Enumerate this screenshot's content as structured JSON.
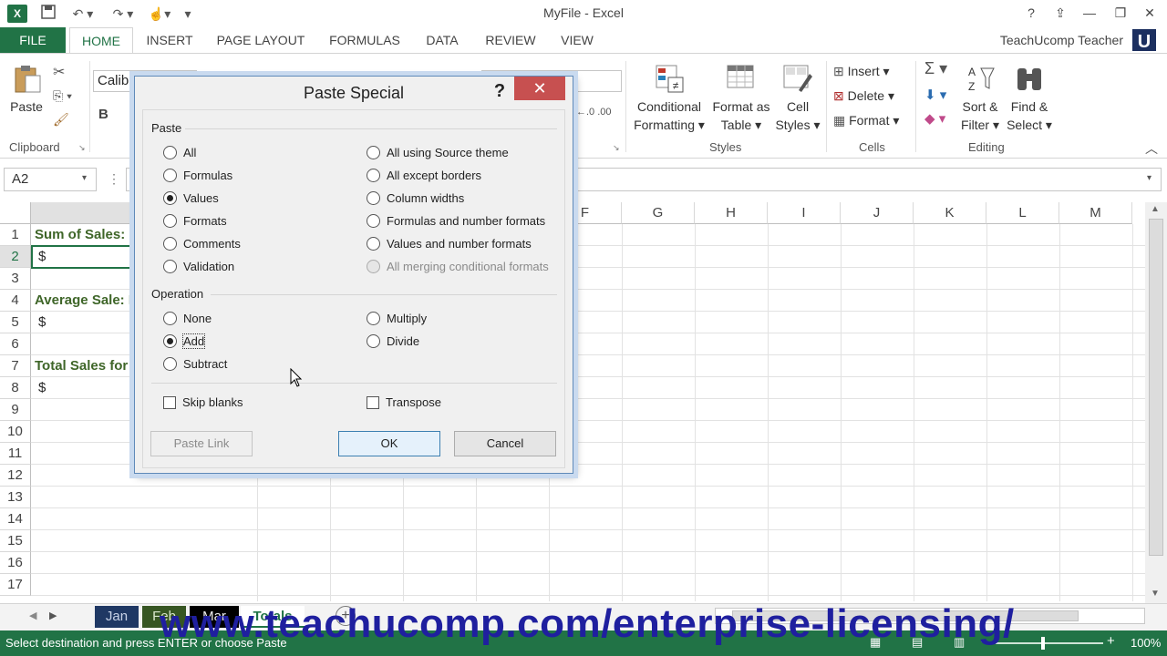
{
  "app": {
    "title": "MyFile - Excel",
    "user": "TeachUcomp Teacher",
    "avatar_letter": "U"
  },
  "ribbon_tabs": [
    "FILE",
    "HOME",
    "INSERT",
    "PAGE LAYOUT",
    "FORMULAS",
    "DATA",
    "REVIEW",
    "VIEW"
  ],
  "ribbon": {
    "paste_label": "Paste",
    "clipboard_label": "Clipboard",
    "font_name": "Calibri",
    "conditional_formatting": [
      "Conditional",
      "Formatting"
    ],
    "format_as_table": [
      "Format as",
      "Table"
    ],
    "cell_styles": [
      "Cell",
      "Styles"
    ],
    "styles_label": "Styles",
    "insert_label": "Insert",
    "delete_label": "Delete",
    "format_label": "Format",
    "cells_label": "Cells",
    "sort_filter": [
      "Sort &",
      "Filter"
    ],
    "find_select": [
      "Find &",
      "Select"
    ],
    "editing_label": "Editing"
  },
  "formula_bar": {
    "name_box": "A2",
    "value": ""
  },
  "grid": {
    "column_headers": [
      "F",
      "G",
      "H",
      "I",
      "J",
      "K",
      "L",
      "M"
    ],
    "row_numbers": [
      "1",
      "2",
      "3",
      "4",
      "5",
      "6",
      "7",
      "8",
      "9",
      "10",
      "11",
      "12",
      "13",
      "14",
      "15",
      "16",
      "17"
    ],
    "active_row": "2",
    "cells": {
      "a1": "Sum of Sales: C",
      "a2": "$",
      "a4": "Average Sale: M",
      "a5": "$",
      "a7": "Total Sales for",
      "a8": "$"
    }
  },
  "sheet_tabs": [
    {
      "name": "Jan",
      "color": "#1f3864"
    },
    {
      "name": "Feb",
      "color": "#375623"
    },
    {
      "name": "Mar",
      "color": "#000000"
    },
    {
      "name": "Totals",
      "color": "#ffffff"
    }
  ],
  "status": {
    "message": "Select destination and press ENTER or choose Paste",
    "zoom": "100%"
  },
  "watermark": "www.teachucomp.com/enterprise-licensing/",
  "dialog": {
    "title": "Paste Special",
    "help": "?",
    "close": "✕",
    "paste_section": "Paste",
    "paste_options_left": [
      "All",
      "Formulas",
      "Values",
      "Formats",
      "Comments",
      "Validation"
    ],
    "paste_options_right": [
      "All using Source theme",
      "All except borders",
      "Column widths",
      "Formulas and number formats",
      "Values and number formats",
      "All merging conditional formats"
    ],
    "paste_selected": "Values",
    "operation_section": "Operation",
    "operation_left": [
      "None",
      "Add",
      "Subtract"
    ],
    "operation_right": [
      "Multiply",
      "Divide"
    ],
    "operation_selected": "Add",
    "skip_blanks": "Skip blanks",
    "transpose": "Transpose",
    "paste_link": "Paste Link",
    "ok": "OK",
    "cancel": "Cancel"
  }
}
